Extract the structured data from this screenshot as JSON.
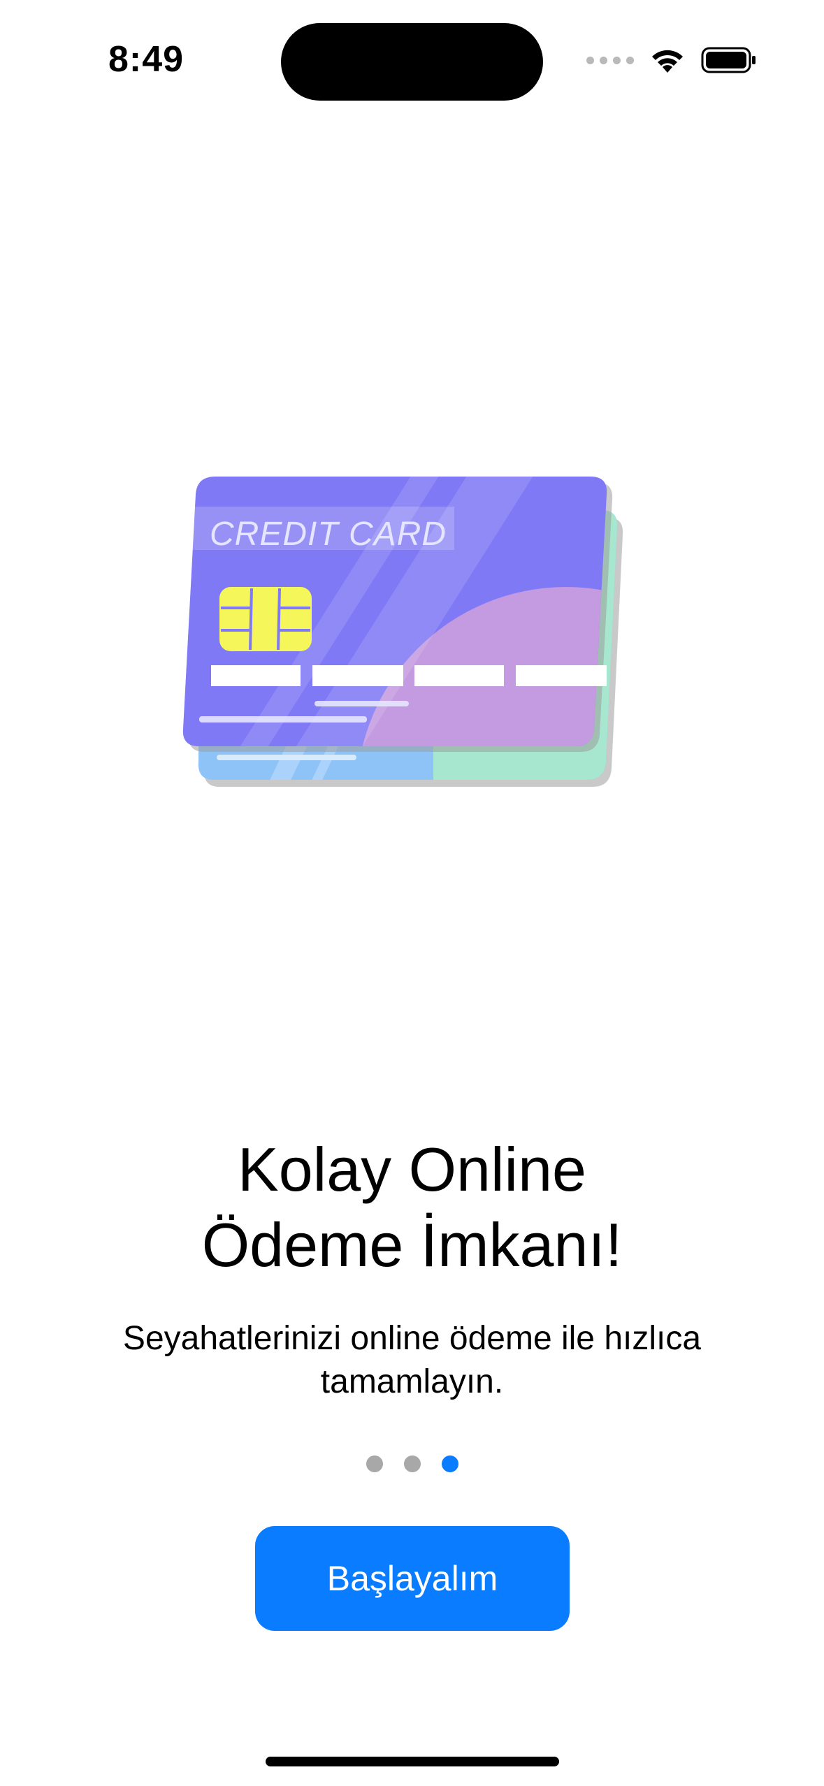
{
  "status_bar": {
    "time": "8:49"
  },
  "illustration": {
    "card_label": "CREDIT CARD",
    "colors": {
      "card_front": "#8079f5",
      "card_blob": "#c49ae0",
      "card_back_blue": "#8ec3f8",
      "card_back_green": "#a7e6cf",
      "chip": "#f4f65a"
    }
  },
  "onboarding": {
    "title": "Kolay Online\nÖdeme İmkanı!",
    "subtitle": "Seyahatlerinizi online ödeme ile hızlıca tamamlayın.",
    "page_count": 3,
    "active_page": 3,
    "button_label": "Başlayalım"
  },
  "colors": {
    "accent": "#0a7cff",
    "dot_inactive": "#a8a8a8"
  }
}
